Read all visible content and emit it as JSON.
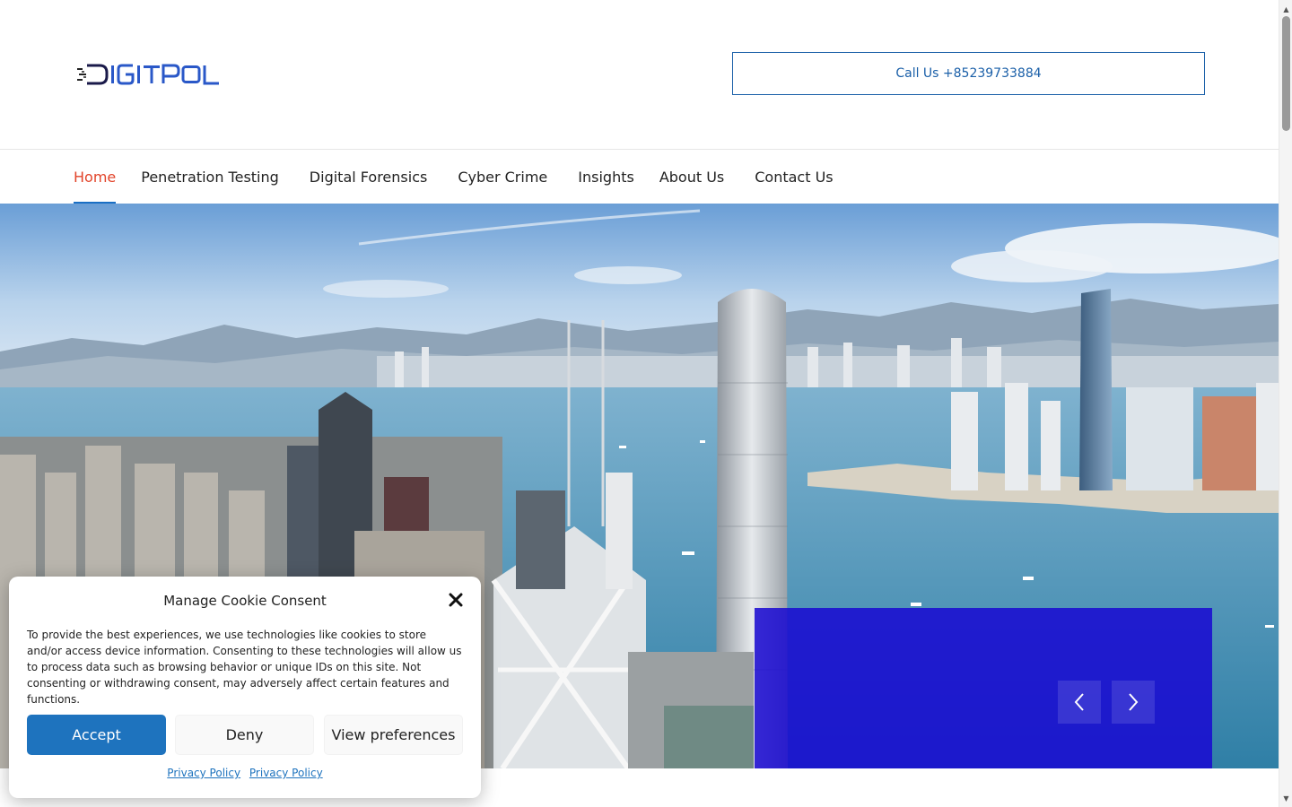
{
  "header": {
    "logo_text": "DIGITPOL",
    "call_button": "Call Us +85239733884"
  },
  "nav": {
    "items": [
      {
        "label": "Home",
        "active": true
      },
      {
        "label": "Penetration Testing",
        "active": false
      },
      {
        "label": "Digital Forensics",
        "active": false
      },
      {
        "label": "Cyber Crime",
        "active": false
      },
      {
        "label": "Insights",
        "active": false
      },
      {
        "label": "About Us",
        "active": false
      },
      {
        "label": "Contact Us",
        "active": false
      }
    ]
  },
  "hero": {
    "image_subject": "Hong Kong harbour skyline",
    "slide_prev_icon": "chevron-left-icon",
    "slide_next_icon": "chevron-right-icon"
  },
  "cookie": {
    "title": "Manage Cookie Consent",
    "body": "To provide the best experiences, we use technologies like cookies to store and/or access device information. Consenting to these technologies will allow us to process data such as browsing behavior or unique IDs on this site. Not consenting or withdrawing consent, may adversely affect certain features and functions.",
    "accept": "Accept",
    "deny": "Deny",
    "preferences": "View preferences",
    "link_1": "Privacy Policy",
    "link_2": "Privacy Policy"
  },
  "colors": {
    "brand_blue": "#1a5fa8",
    "nav_active": "#e2442a",
    "nav_underline": "#1a6fc4",
    "slide_box": "#1808d2",
    "accept_button": "#1e73be"
  }
}
